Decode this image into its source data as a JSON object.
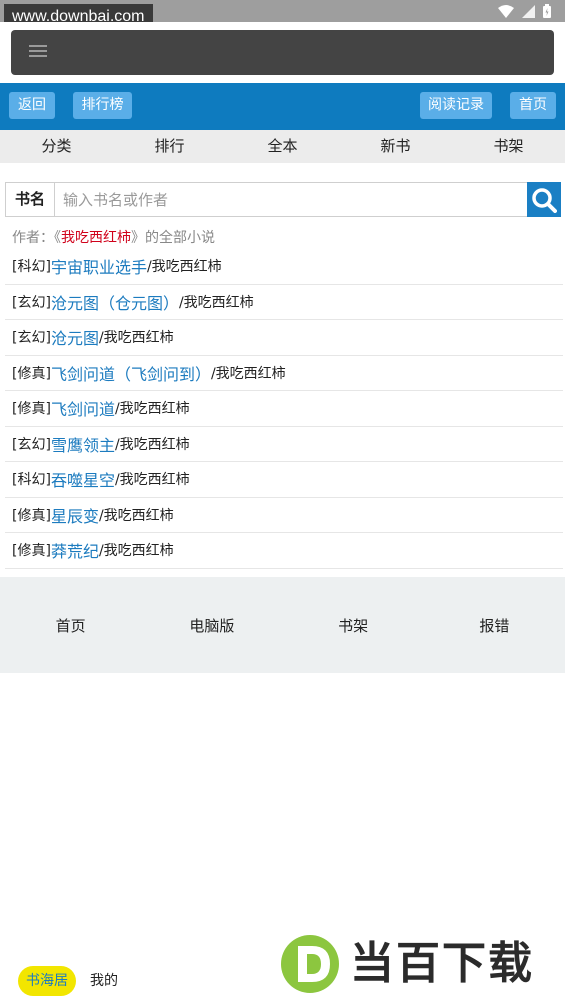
{
  "watermark_url": "www.downbai.com",
  "nav": {
    "back": "返回",
    "ranking": "排行榜",
    "history": "阅读记录",
    "home": "首页"
  },
  "categories": [
    "分类",
    "排行",
    "全本",
    "新书",
    "书架"
  ],
  "search": {
    "label": "书名",
    "placeholder": "输入书名或作者"
  },
  "author_info": {
    "prefix": "作者：《",
    "name": "我吃西红柿",
    "suffix": "》的全部小说"
  },
  "books": [
    {
      "genre": "[科幻]",
      "title": "宇宙职业选手",
      "author": "/我吃西红柿"
    },
    {
      "genre": "[玄幻]",
      "title": "沧元图（仓元图）",
      "author": "/我吃西红柿"
    },
    {
      "genre": "[玄幻]",
      "title": "沧元图",
      "author": "/我吃西红柿"
    },
    {
      "genre": "[修真]",
      "title": "飞剑问道（飞剑问到）",
      "author": "/我吃西红柿"
    },
    {
      "genre": "[修真]",
      "title": "飞剑问道",
      "author": "/我吃西红柿"
    },
    {
      "genre": "[玄幻]",
      "title": "雪鹰领主",
      "author": "/我吃西红柿"
    },
    {
      "genre": "[科幻]",
      "title": "吞噬星空",
      "author": "/我吃西红柿"
    },
    {
      "genre": "[修真]",
      "title": "星辰变",
      "author": "/我吃西红柿"
    },
    {
      "genre": "[修真]",
      "title": "莽荒纪",
      "author": "/我吃西红柿"
    }
  ],
  "footer": [
    "首页",
    "电脑版",
    "书架",
    "报错"
  ],
  "bottom_tabs": {
    "active": "书海居",
    "mine": "我的"
  },
  "watermark_logo_text": "当百下载",
  "colors": {
    "nav_blue": "#0e7bbf",
    "button_blue": "#5aaee8",
    "link_blue": "#1c7bbf",
    "author_red": "#d0021b",
    "tab_yellow": "#f2e600",
    "logo_green": "#8cc63f"
  }
}
